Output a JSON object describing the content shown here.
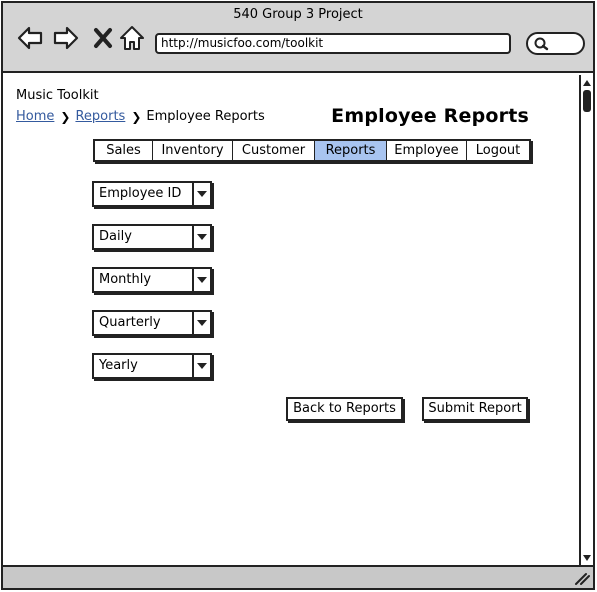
{
  "window": {
    "title": "540 Group 3 Project",
    "url": "http://musicfoo.com/toolkit"
  },
  "app": {
    "name": "Music Toolkit",
    "page_title": "Employee Reports"
  },
  "breadcrumb": {
    "home": "Home",
    "reports": "Reports",
    "current": "Employee Reports"
  },
  "tabs": [
    {
      "label": "Sales",
      "active": false
    },
    {
      "label": "Inventory",
      "active": false
    },
    {
      "label": "Customer",
      "active": false
    },
    {
      "label": "Reports",
      "active": true
    },
    {
      "label": "Employee",
      "active": false
    },
    {
      "label": "Logout",
      "active": false
    }
  ],
  "selects": [
    {
      "value": "Employee ID"
    },
    {
      "value": "Daily"
    },
    {
      "value": "Monthly"
    },
    {
      "value": "Quarterly"
    },
    {
      "value": "Yearly"
    }
  ],
  "buttons": {
    "back": "Back to Reports",
    "submit": "Submit Report"
  },
  "colors": {
    "active_tab": "#a8c4f0",
    "link": "#345a9e",
    "chrome": "#d4d4d4"
  },
  "icons": [
    "back-arrow-icon",
    "forward-arrow-icon",
    "close-icon",
    "home-icon",
    "search-icon",
    "chevron-down-icon",
    "resize-grip-icon"
  ]
}
